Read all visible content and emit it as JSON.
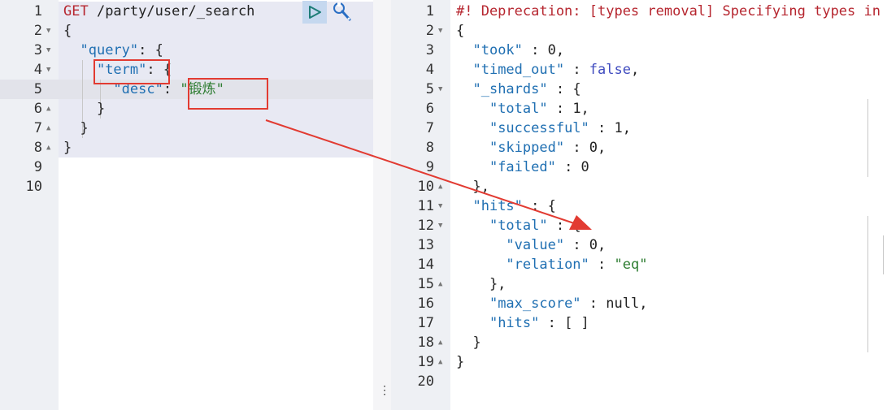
{
  "colors": {
    "annotation": "#e23b32",
    "run_button_bg": "#c5d8ef",
    "gutter_bg": "#eef0f4"
  },
  "request": {
    "toolbar": {
      "run_icon": "play-icon",
      "settings_icon": "wrench-icon"
    },
    "lines": [
      {
        "n": "1",
        "fold": "",
        "parts": [
          [
            "m",
            "GET"
          ],
          [
            "n",
            " /party/user/_search"
          ]
        ]
      },
      {
        "n": "2",
        "fold": "▼",
        "parts": [
          [
            "n",
            "{"
          ]
        ]
      },
      {
        "n": "3",
        "fold": "▼",
        "parts": [
          [
            "n",
            "  "
          ],
          [
            "k",
            "\"query\""
          ],
          [
            "n",
            ": {"
          ]
        ]
      },
      {
        "n": "4",
        "fold": "▼",
        "parts": [
          [
            "n",
            "    "
          ],
          [
            "k",
            "\"term\""
          ],
          [
            "n",
            ": {"
          ]
        ]
      },
      {
        "n": "5",
        "fold": "",
        "parts": [
          [
            "n",
            "      "
          ],
          [
            "k",
            "\"desc\""
          ],
          [
            "n",
            ": "
          ],
          [
            "s",
            "\"锻炼\""
          ]
        ]
      },
      {
        "n": "6",
        "fold": "▲",
        "parts": [
          [
            "n",
            "    }"
          ]
        ]
      },
      {
        "n": "7",
        "fold": "▲",
        "parts": [
          [
            "n",
            "  }"
          ]
        ]
      },
      {
        "n": "8",
        "fold": "▲",
        "parts": [
          [
            "n",
            "}"
          ]
        ]
      },
      {
        "n": "9",
        "fold": "",
        "parts": []
      },
      {
        "n": "10",
        "fold": "",
        "parts": []
      }
    ]
  },
  "response": {
    "lines": [
      {
        "n": "1",
        "fold": "",
        "parts": [
          [
            "m",
            "#! Deprecation: [types removal] Specifying types in search requests is deprecated."
          ]
        ]
      },
      {
        "n": "2",
        "fold": "▼",
        "parts": [
          [
            "n",
            "{"
          ]
        ]
      },
      {
        "n": "3",
        "fold": "",
        "parts": [
          [
            "n",
            "  "
          ],
          [
            "k",
            "\"took\""
          ],
          [
            "n",
            " : 0,"
          ]
        ]
      },
      {
        "n": "4",
        "fold": "",
        "parts": [
          [
            "n",
            "  "
          ],
          [
            "k",
            "\"timed_out\""
          ],
          [
            "n",
            " : "
          ],
          [
            "b",
            "false"
          ],
          [
            "n",
            ","
          ]
        ]
      },
      {
        "n": "5",
        "fold": "▼",
        "parts": [
          [
            "n",
            "  "
          ],
          [
            "k",
            "\"_shards\""
          ],
          [
            "n",
            " : {"
          ]
        ]
      },
      {
        "n": "6",
        "fold": "",
        "parts": [
          [
            "n",
            "    "
          ],
          [
            "k",
            "\"total\""
          ],
          [
            "n",
            " : 1,"
          ]
        ]
      },
      {
        "n": "7",
        "fold": "",
        "parts": [
          [
            "n",
            "    "
          ],
          [
            "k",
            "\"successful\""
          ],
          [
            "n",
            " : 1,"
          ]
        ]
      },
      {
        "n": "8",
        "fold": "",
        "parts": [
          [
            "n",
            "    "
          ],
          [
            "k",
            "\"skipped\""
          ],
          [
            "n",
            " : 0,"
          ]
        ]
      },
      {
        "n": "9",
        "fold": "",
        "parts": [
          [
            "n",
            "    "
          ],
          [
            "k",
            "\"failed\""
          ],
          [
            "n",
            " : 0"
          ]
        ]
      },
      {
        "n": "10",
        "fold": "▲",
        "parts": [
          [
            "n",
            "  },"
          ]
        ]
      },
      {
        "n": "11",
        "fold": "▼",
        "parts": [
          [
            "n",
            "  "
          ],
          [
            "k",
            "\"hits\""
          ],
          [
            "n",
            " : {"
          ]
        ]
      },
      {
        "n": "12",
        "fold": "▼",
        "parts": [
          [
            "n",
            "    "
          ],
          [
            "k",
            "\"total\""
          ],
          [
            "n",
            " : {"
          ]
        ]
      },
      {
        "n": "13",
        "fold": "",
        "parts": [
          [
            "n",
            "      "
          ],
          [
            "k",
            "\"value\""
          ],
          [
            "n",
            " : 0,"
          ]
        ]
      },
      {
        "n": "14",
        "fold": "",
        "parts": [
          [
            "n",
            "      "
          ],
          [
            "k",
            "\"relation\""
          ],
          [
            "n",
            " : "
          ],
          [
            "s",
            "\"eq\""
          ]
        ]
      },
      {
        "n": "15",
        "fold": "▲",
        "parts": [
          [
            "n",
            "    },"
          ]
        ]
      },
      {
        "n": "16",
        "fold": "",
        "parts": [
          [
            "n",
            "    "
          ],
          [
            "k",
            "\"max_score\""
          ],
          [
            "n",
            " : null,"
          ]
        ]
      },
      {
        "n": "17",
        "fold": "",
        "parts": [
          [
            "n",
            "    "
          ],
          [
            "k",
            "\"hits\""
          ],
          [
            "n",
            " : [ ]"
          ]
        ]
      },
      {
        "n": "18",
        "fold": "▲",
        "parts": [
          [
            "n",
            "  }"
          ]
        ]
      },
      {
        "n": "19",
        "fold": "▲",
        "parts": [
          [
            "n",
            "}"
          ]
        ]
      },
      {
        "n": "20",
        "fold": "",
        "parts": []
      }
    ]
  },
  "divider": {
    "handle": "⋮"
  }
}
